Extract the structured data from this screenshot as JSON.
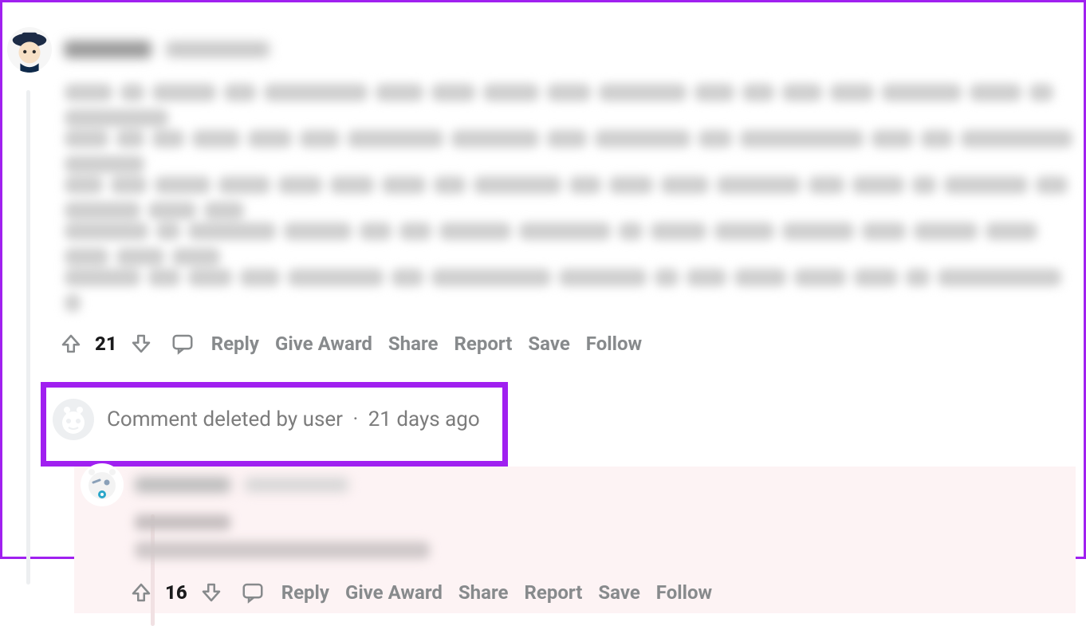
{
  "comment1": {
    "score": "21",
    "actions": {
      "reply": "Reply",
      "award": "Give Award",
      "share": "Share",
      "report": "Report",
      "save": "Save",
      "follow": "Follow"
    }
  },
  "deleted": {
    "text": "Comment deleted by user",
    "time": "21 days ago",
    "dot": "·"
  },
  "reply": {
    "score": "16",
    "actions": {
      "reply": "Reply",
      "award": "Give Award",
      "share": "Share",
      "report": "Report",
      "save": "Save",
      "follow": "Follow"
    }
  }
}
